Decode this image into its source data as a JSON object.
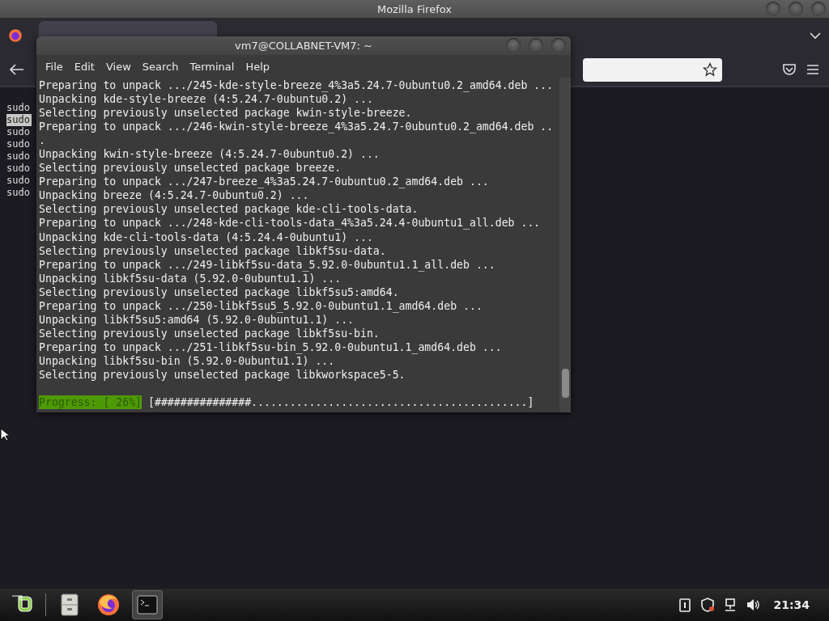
{
  "browser": {
    "title": "Mozilla Firefox",
    "content_lines": [
      {
        "text": "sudo",
        "selected": false
      },
      {
        "text": "sudo",
        "selected": true
      },
      {
        "text": "sudo",
        "selected": false
      },
      {
        "text": "sudo",
        "selected": false
      },
      {
        "text": "sudo",
        "selected": false
      },
      {
        "text": "sudo",
        "selected": false
      },
      {
        "text": "sudo",
        "selected": false
      },
      {
        "text": "sudo",
        "selected": false
      }
    ]
  },
  "terminal": {
    "title": "vm7@COLLABNET-VM7: ~",
    "menu": [
      "File",
      "Edit",
      "View",
      "Search",
      "Terminal",
      "Help"
    ],
    "lines": [
      "Preparing to unpack .../245-kde-style-breeze_4%3a5.24.7-0ubuntu0.2_amd64.deb ...",
      "Unpacking kde-style-breeze (4:5.24.7-0ubuntu0.2) ...",
      "Selecting previously unselected package kwin-style-breeze.",
      "Preparing to unpack .../246-kwin-style-breeze_4%3a5.24.7-0ubuntu0.2_amd64.deb ..",
      ".",
      "Unpacking kwin-style-breeze (4:5.24.7-0ubuntu0.2) ...",
      "Selecting previously unselected package breeze.",
      "Preparing to unpack .../247-breeze_4%3a5.24.7-0ubuntu0.2_amd64.deb ...",
      "Unpacking breeze (4:5.24.7-0ubuntu0.2) ...",
      "Selecting previously unselected package kde-cli-tools-data.",
      "Preparing to unpack .../248-kde-cli-tools-data_4%3a5.24.4-0ubuntu1_all.deb ...",
      "Unpacking kde-cli-tools-data (4:5.24.4-0ubuntu1) ...",
      "Selecting previously unselected package libkf5su-data.",
      "Preparing to unpack .../249-libkf5su-data_5.92.0-0ubuntu1.1_all.deb ...",
      "Unpacking libkf5su-data (5.92.0-0ubuntu1.1) ...",
      "Selecting previously unselected package libkf5su5:amd64.",
      "Preparing to unpack .../250-libkf5su5_5.92.0-0ubuntu1.1_amd64.deb ...",
      "Unpacking libkf5su5:amd64 (5.92.0-0ubuntu1.1) ...",
      "Selecting previously unselected package libkf5su-bin.",
      "Preparing to unpack .../251-libkf5su-bin_5.92.0-0ubuntu1.1_amd64.deb ...",
      "Unpacking libkf5su-bin (5.92.0-0ubuntu1.1) ...",
      "Selecting previously unselected package libkworkspace5-5."
    ],
    "progress": {
      "label": "Progress: [ 26%]",
      "bar": "[###############...........................................]"
    }
  },
  "taskbar": {
    "apps": [
      {
        "kind": "menu",
        "selected": false
      },
      {
        "kind": "files",
        "selected": false
      },
      {
        "kind": "firefox",
        "selected": false
      },
      {
        "kind": "terminal",
        "selected": true
      }
    ],
    "clock": "21:34"
  }
}
